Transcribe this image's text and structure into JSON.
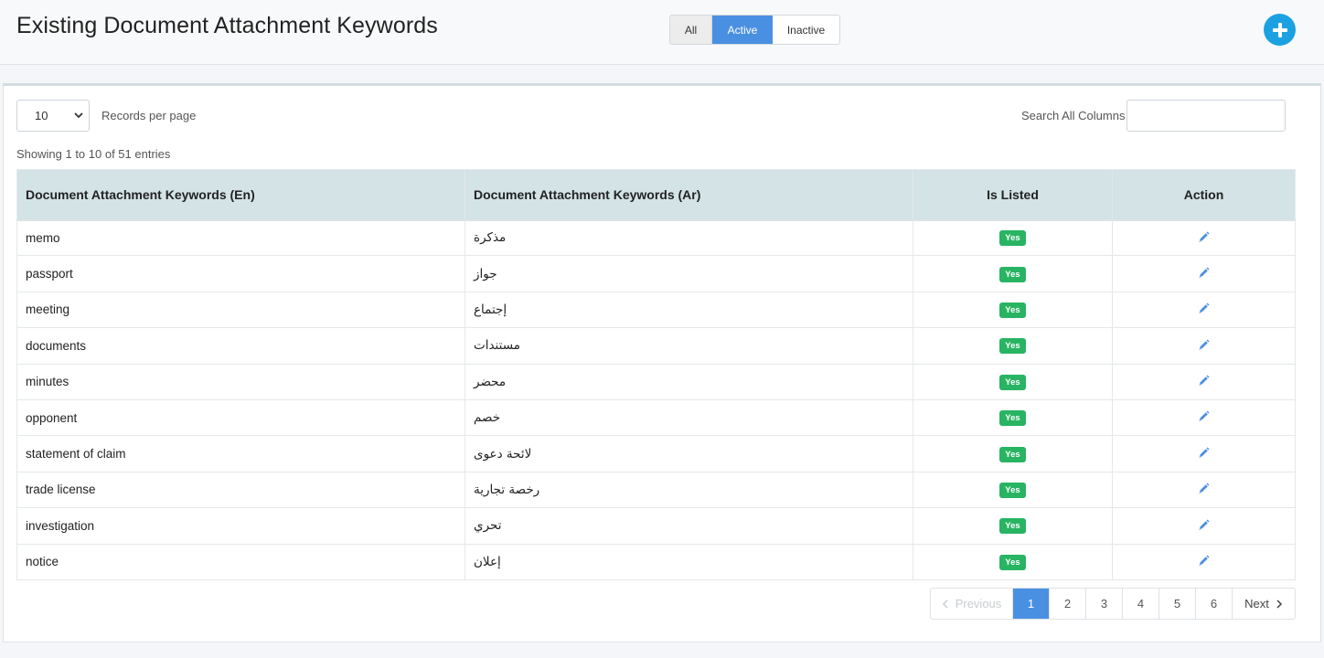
{
  "header": {
    "title": "Existing Document Attachment Keywords",
    "filters": {
      "all": "All",
      "active": "Active",
      "inactive": "Inactive",
      "selected": "Active"
    },
    "add_icon": "plus-circle-icon",
    "accent_color": "#1ba1e2"
  },
  "controls": {
    "per_page_value": "10",
    "per_page_label": "Records per page",
    "search_label": "Search All Columns",
    "search_value": "",
    "showing": "Showing 1 to 10 of 51 entries"
  },
  "table": {
    "columns": [
      "Document Attachment Keywords (En)",
      "Document Attachment Keywords (Ar)",
      "Is Listed",
      "Action"
    ],
    "rows": [
      {
        "en": "memo",
        "ar": "مذكرة",
        "listed": "Yes"
      },
      {
        "en": "passport",
        "ar": "جواز",
        "listed": "Yes"
      },
      {
        "en": "meeting",
        "ar": "إجتماع",
        "listed": "Yes"
      },
      {
        "en": "documents",
        "ar": "مستندات",
        "listed": "Yes"
      },
      {
        "en": "minutes",
        "ar": "محضر",
        "listed": "Yes"
      },
      {
        "en": "opponent",
        "ar": "خصم",
        "listed": "Yes"
      },
      {
        "en": "statement of claim",
        "ar": "لائحة دعوى",
        "listed": "Yes"
      },
      {
        "en": "trade license",
        "ar": "رخصة تجارية",
        "listed": "Yes"
      },
      {
        "en": "investigation",
        "ar": "تحري",
        "listed": "Yes"
      },
      {
        "en": "notice",
        "ar": "إعلان",
        "listed": "Yes"
      }
    ],
    "badge_color": "#28b463",
    "action_icon": "pencil-icon"
  },
  "pagination": {
    "previous": "Previous",
    "pages": [
      "1",
      "2",
      "3",
      "4",
      "5",
      "6"
    ],
    "current": "1",
    "next": "Next"
  }
}
